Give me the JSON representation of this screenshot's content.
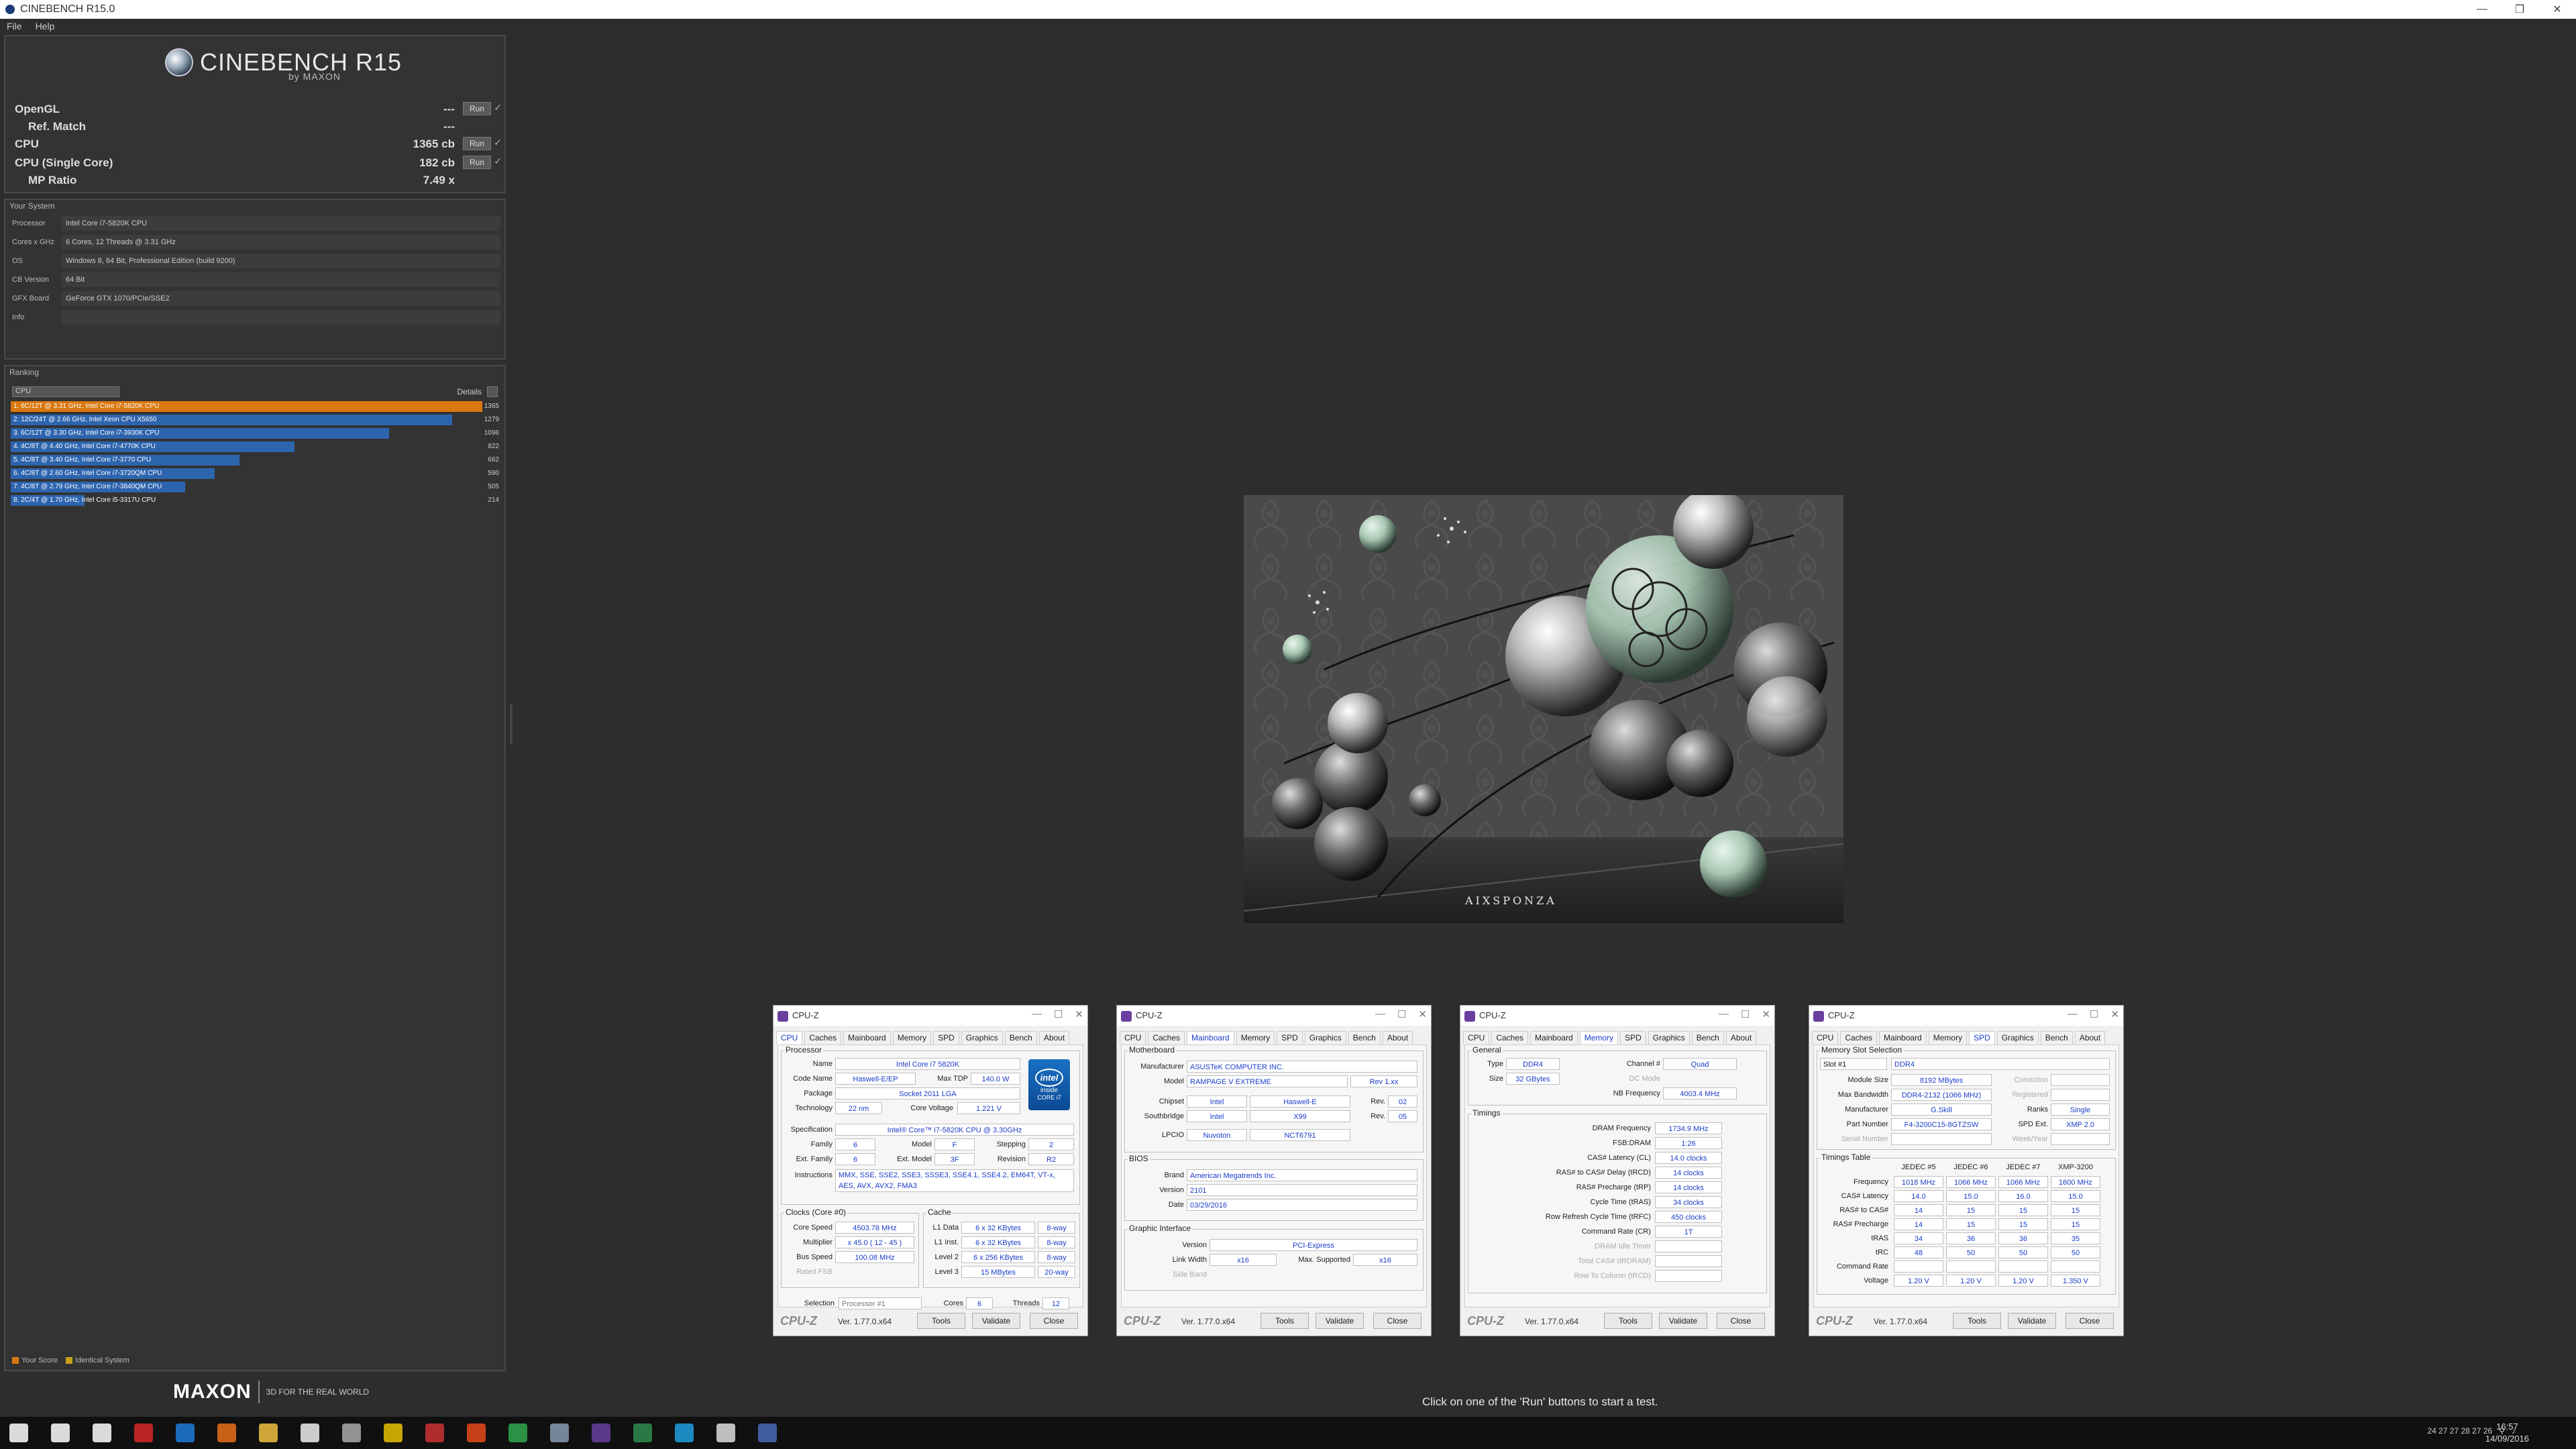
{
  "window": {
    "title": "CINEBENCH R15.0",
    "minimize": "—",
    "maximize": "❐",
    "close": "✕"
  },
  "menu": {
    "file": "File",
    "help": "Help"
  },
  "logo": {
    "name": "CINEBENCH R15",
    "by": "by MAXON"
  },
  "scores": [
    {
      "label": "OpenGL",
      "value": "---",
      "run": "Run",
      "check": "✓"
    },
    {
      "label": "Ref. Match",
      "value": "---"
    },
    {
      "label": "CPU",
      "value": "1365 cb",
      "run": "Run",
      "check": "✓"
    },
    {
      "label": "CPU (Single Core)",
      "value": "182 cb",
      "run": "Run",
      "check": "✓"
    },
    {
      "label": "MP Ratio",
      "value": "7.49 x"
    }
  ],
  "system": {
    "title": "Your System",
    "rows": [
      {
        "k": "Processor",
        "v": "Intel Core i7-5820K CPU"
      },
      {
        "k": "Cores x GHz",
        "v": "6 Cores, 12 Threads @ 3.31 GHz"
      },
      {
        "k": "OS",
        "v": "Windows 8, 64 Bit, Professional Edition (build 9200)"
      },
      {
        "k": "CB Version",
        "v": "64 Bit"
      },
      {
        "k": "GFX Board",
        "v": "GeForce GTX 1070/PCIe/SSE2"
      },
      {
        "k": "Info",
        "v": ""
      }
    ]
  },
  "ranking": {
    "title": "Ranking",
    "select": "CPU",
    "details": "Details",
    "max": 1365,
    "rows": [
      {
        "label": "1. 6C/12T @ 3.31 GHz, Intel Core i7-5820K CPU",
        "score": 1365,
        "color": "#d9780f"
      },
      {
        "label": "2. 12C/24T @ 2.66 GHz, Intel Xeon CPU X5650",
        "score": 1279,
        "color": "#2d64ae"
      },
      {
        "label": "3. 6C/12T @ 3.30 GHz, Intel Core i7-3930K CPU",
        "score": 1096,
        "color": "#2d64ae"
      },
      {
        "label": "4. 4C/8T @ 4.40 GHz, Intel Core i7-4770K CPU",
        "score": 822,
        "color": "#2d64ae"
      },
      {
        "label": "5. 4C/8T @ 3.40 GHz, Intel Core i7-3770 CPU",
        "score": 662,
        "color": "#2d64ae"
      },
      {
        "label": "6. 4C/8T @ 2.60 GHz, Intel Core i7-3720QM CPU",
        "score": 590,
        "color": "#2d64ae"
      },
      {
        "label": "7. 4C/8T @ 2.79 GHz, Intel Core i7-3840QM CPU",
        "score": 505,
        "color": "#2d64ae"
      },
      {
        "label": "8. 2C/4T @ 1.70 GHz, Intel Core i5-3317U CPU",
        "score": 214,
        "color": "#2d64ae"
      }
    ],
    "legend_your": "Your Score",
    "legend_ident": "Identical System",
    "color_your": "#d9780f",
    "color_ident": "#c8a020"
  },
  "footer": {
    "maxon": "MAXON",
    "slogan": "3D FOR THE REAL WORLD",
    "hint": "Click on one of the 'Run' buttons to start a test."
  },
  "render": {
    "watermark": "AIXSPONZA"
  },
  "cpuz_common": {
    "title": "CPU-Z",
    "brand": "CPU-Z",
    "version": "Ver. 1.77.0.x64",
    "tools": "Tools",
    "validate": "Validate",
    "close": "Close",
    "tabs": [
      "CPU",
      "Caches",
      "Mainboard",
      "Memory",
      "SPD",
      "Graphics",
      "Bench",
      "About"
    ]
  },
  "cpuz1": {
    "processor": "Processor",
    "name_l": "Name",
    "name": "Intel Core i7 5820K",
    "code_l": "Code Name",
    "code": "Haswell-E/EP",
    "tdp_l": "Max TDP",
    "tdp": "140.0 W",
    "pkg_l": "Package",
    "pkg": "Socket 2011 LGA",
    "tech_l": "Technology",
    "tech": "22 nm",
    "cv_l": "Core Voltage",
    "cv": "1.221 V",
    "spec_l": "Specification",
    "spec": "Intel® Core™ i7-5820K CPU @ 3.30GHz",
    "fam_l": "Family",
    "fam": "6",
    "mod_l": "Model",
    "mod": "F",
    "step_l": "Stepping",
    "step": "2",
    "efam_l": "Ext. Family",
    "efam": "6",
    "emod_l": "Ext. Model",
    "emod": "3F",
    "rev_l": "Revision",
    "rev": "R2",
    "ins_l": "Instructions",
    "ins": "MMX, SSE, SSE2, SSE3, SSSE3, SSE4.1, SSE4.2, EM64T, VT-x, AES, AVX, AVX2, FMA3",
    "clocks": "Clocks (Core #0)",
    "cache": "Cache",
    "cs_l": "Core Speed",
    "cs": "4503.78 MHz",
    "mult_l": "Multiplier",
    "mult": "x 45.0 ( 12 - 45 )",
    "bus_l": "Bus Speed",
    "bus": "100.08 MHz",
    "fsb_l": "Rated FSB",
    "fsb": "",
    "l1d_l": "L1 Data",
    "l1d": "6 x 32 KBytes",
    "l1d_w": "8-way",
    "l1i_l": "L1 Inst.",
    "l1i": "6 x 32 KBytes",
    "l1i_w": "8-way",
    "l2_l": "Level 2",
    "l2": "6 x 256 KBytes",
    "l2_w": "8-way",
    "l3_l": "Level 3",
    "l3": "15 MBytes",
    "l3_w": "20-way",
    "sel_l": "Selection",
    "sel": "Processor #1",
    "cores_l": "Cores",
    "cores": "6",
    "thr_l": "Threads",
    "thr": "12",
    "intel_brand": "intel",
    "intel_line1": "inside",
    "intel_line2": "CORE i7"
  },
  "cpuz2": {
    "mb": "Motherboard",
    "man_l": "Manufacturer",
    "man": "ASUSTeK COMPUTER INC.",
    "model_l": "Model",
    "model": "RAMPAGE V EXTREME",
    "model_rev": "Rev 1.xx",
    "chip_l": "Chipset",
    "chip": "Intel",
    "chip2": "Haswell-E",
    "chip_rev_l": "Rev.",
    "chip_rev": "02",
    "sb_l": "Southbridge",
    "sb": "Intel",
    "sb2": "X99",
    "sb_rev_l": "Rev.",
    "sb_rev": "05",
    "lpc_l": "LPCIO",
    "lpc": "Nuvoton",
    "lpc2": "NCT6791",
    "bios": "BIOS",
    "brand_l": "Brand",
    "brand": "American Megatrends Inc.",
    "ver_l": "Version",
    "ver": "2101",
    "date_l": "Date",
    "date": "03/29/2016",
    "gi": "Graphic Interface",
    "giv_l": "Version",
    "giv": "PCI-Express",
    "lw_l": "Link Width",
    "lw": "x16",
    "ms_l": "Max. Supported",
    "ms": "x16",
    "sb2_l": "Side Band",
    "sb2v": ""
  },
  "cpuz3": {
    "gen": "General",
    "type_l": "Type",
    "type": "DDR4",
    "ch_l": "Channel #",
    "ch": "Quad",
    "size_l": "Size",
    "size": "32 GBytes",
    "dc_l": "DC Mode",
    "dc": "",
    "nb_l": "NB Frequency",
    "nb": "4003.4 MHz",
    "tim": "Timings",
    "rows": [
      {
        "l": "DRAM Frequency",
        "v": "1734.9 MHz"
      },
      {
        "l": "FSB:DRAM",
        "v": "1:26"
      },
      {
        "l": "CAS# Latency (CL)",
        "v": "14.0 clocks"
      },
      {
        "l": "RAS# to CAS# Delay (tRCD)",
        "v": "14 clocks"
      },
      {
        "l": "RAS# Precharge (tRP)",
        "v": "14 clocks"
      },
      {
        "l": "Cycle Time (tRAS)",
        "v": "34 clocks"
      },
      {
        "l": "Row Refresh Cycle Time (tRFC)",
        "v": "450 clocks"
      },
      {
        "l": "Command Rate (CR)",
        "v": "1T"
      },
      {
        "l": "DRAM Idle Timer",
        "v": "",
        "dis": true
      },
      {
        "l": "Total CAS# (tRDRAM)",
        "v": "",
        "dis": true
      },
      {
        "l": "Row To Column (tRCD)",
        "v": "",
        "dis": true
      }
    ]
  },
  "cpuz4": {
    "mss": "Memory Slot Selection",
    "slot": "Slot #1",
    "slot_type": "DDR4",
    "ms_l": "Module Size",
    "ms": "8192 MBytes",
    "corr_l": "Correction",
    "corr": "",
    "mb_l": "Max Bandwidth",
    "mb": "DDR4-2132 (1066 MHz)",
    "reg_l": "Registered",
    "reg": "",
    "man_l": "Manufacturer",
    "man": "G.Skill",
    "ranks_l": "Ranks",
    "ranks": "Single",
    "pn_l": "Part Number",
    "pn": "F4-3200C15-8GTZSW",
    "spd_l": "SPD Ext.",
    "spd": "XMP 2.0",
    "sn_l": "Serial Number",
    "sn": "",
    "wy_l": "Week/Year",
    "wy": "",
    "tt": "Timings Table",
    "cols": [
      "JEDEC #5",
      "JEDEC #6",
      "JEDEC #7",
      "XMP-3200"
    ],
    "rows": [
      {
        "l": "Frequency",
        "v": [
          "1018 MHz",
          "1066 MHz",
          "1066 MHz",
          "1600 MHz"
        ]
      },
      {
        "l": "CAS# Latency",
        "v": [
          "14.0",
          "15.0",
          "16.0",
          "15.0"
        ]
      },
      {
        "l": "RAS# to CAS#",
        "v": [
          "14",
          "15",
          "15",
          "15"
        ]
      },
      {
        "l": "RAS# Precharge",
        "v": [
          "14",
          "15",
          "15",
          "15"
        ]
      },
      {
        "l": "tRAS",
        "v": [
          "34",
          "36",
          "36",
          "35"
        ]
      },
      {
        "l": "tRC",
        "v": [
          "48",
          "50",
          "50",
          "50"
        ]
      },
      {
        "l": "Command Rate",
        "v": [
          "",
          "",
          "",
          ""
        ]
      },
      {
        "l": "Voltage",
        "v": [
          "1.20 V",
          "1.20 V",
          "1.20 V",
          "1.350 V"
        ]
      }
    ]
  },
  "clock": {
    "time": "16:57",
    "date": "14/09/2016"
  },
  "tray": {
    "nums": "24 27 27 28 27 26"
  }
}
